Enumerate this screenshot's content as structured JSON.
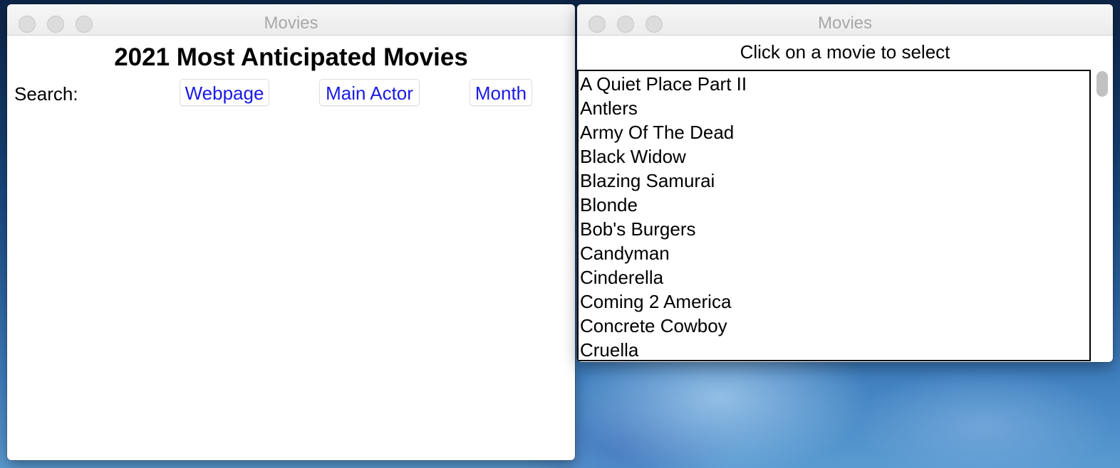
{
  "windows": {
    "left": {
      "title": "Movies",
      "heading": "2021 Most Anticipated Movies",
      "search_label": "Search:",
      "buttons": {
        "webpage": "Webpage",
        "main_actor": "Main Actor",
        "month": "Month"
      }
    },
    "right": {
      "title": "Movies",
      "instruction": "Click on a movie to select",
      "movies": [
        "A Quiet Place Part II",
        "Antlers",
        "Army Of The Dead",
        "Black Widow",
        "Blazing Samurai",
        "Blonde",
        "Bob's Burgers",
        "Candyman",
        "Cinderella",
        "Coming 2 America",
        "Concrete Cowboy",
        "Cruella"
      ]
    }
  },
  "colors": {
    "button_text": "#1a1ae6",
    "title_text": "#a8a8a8"
  }
}
